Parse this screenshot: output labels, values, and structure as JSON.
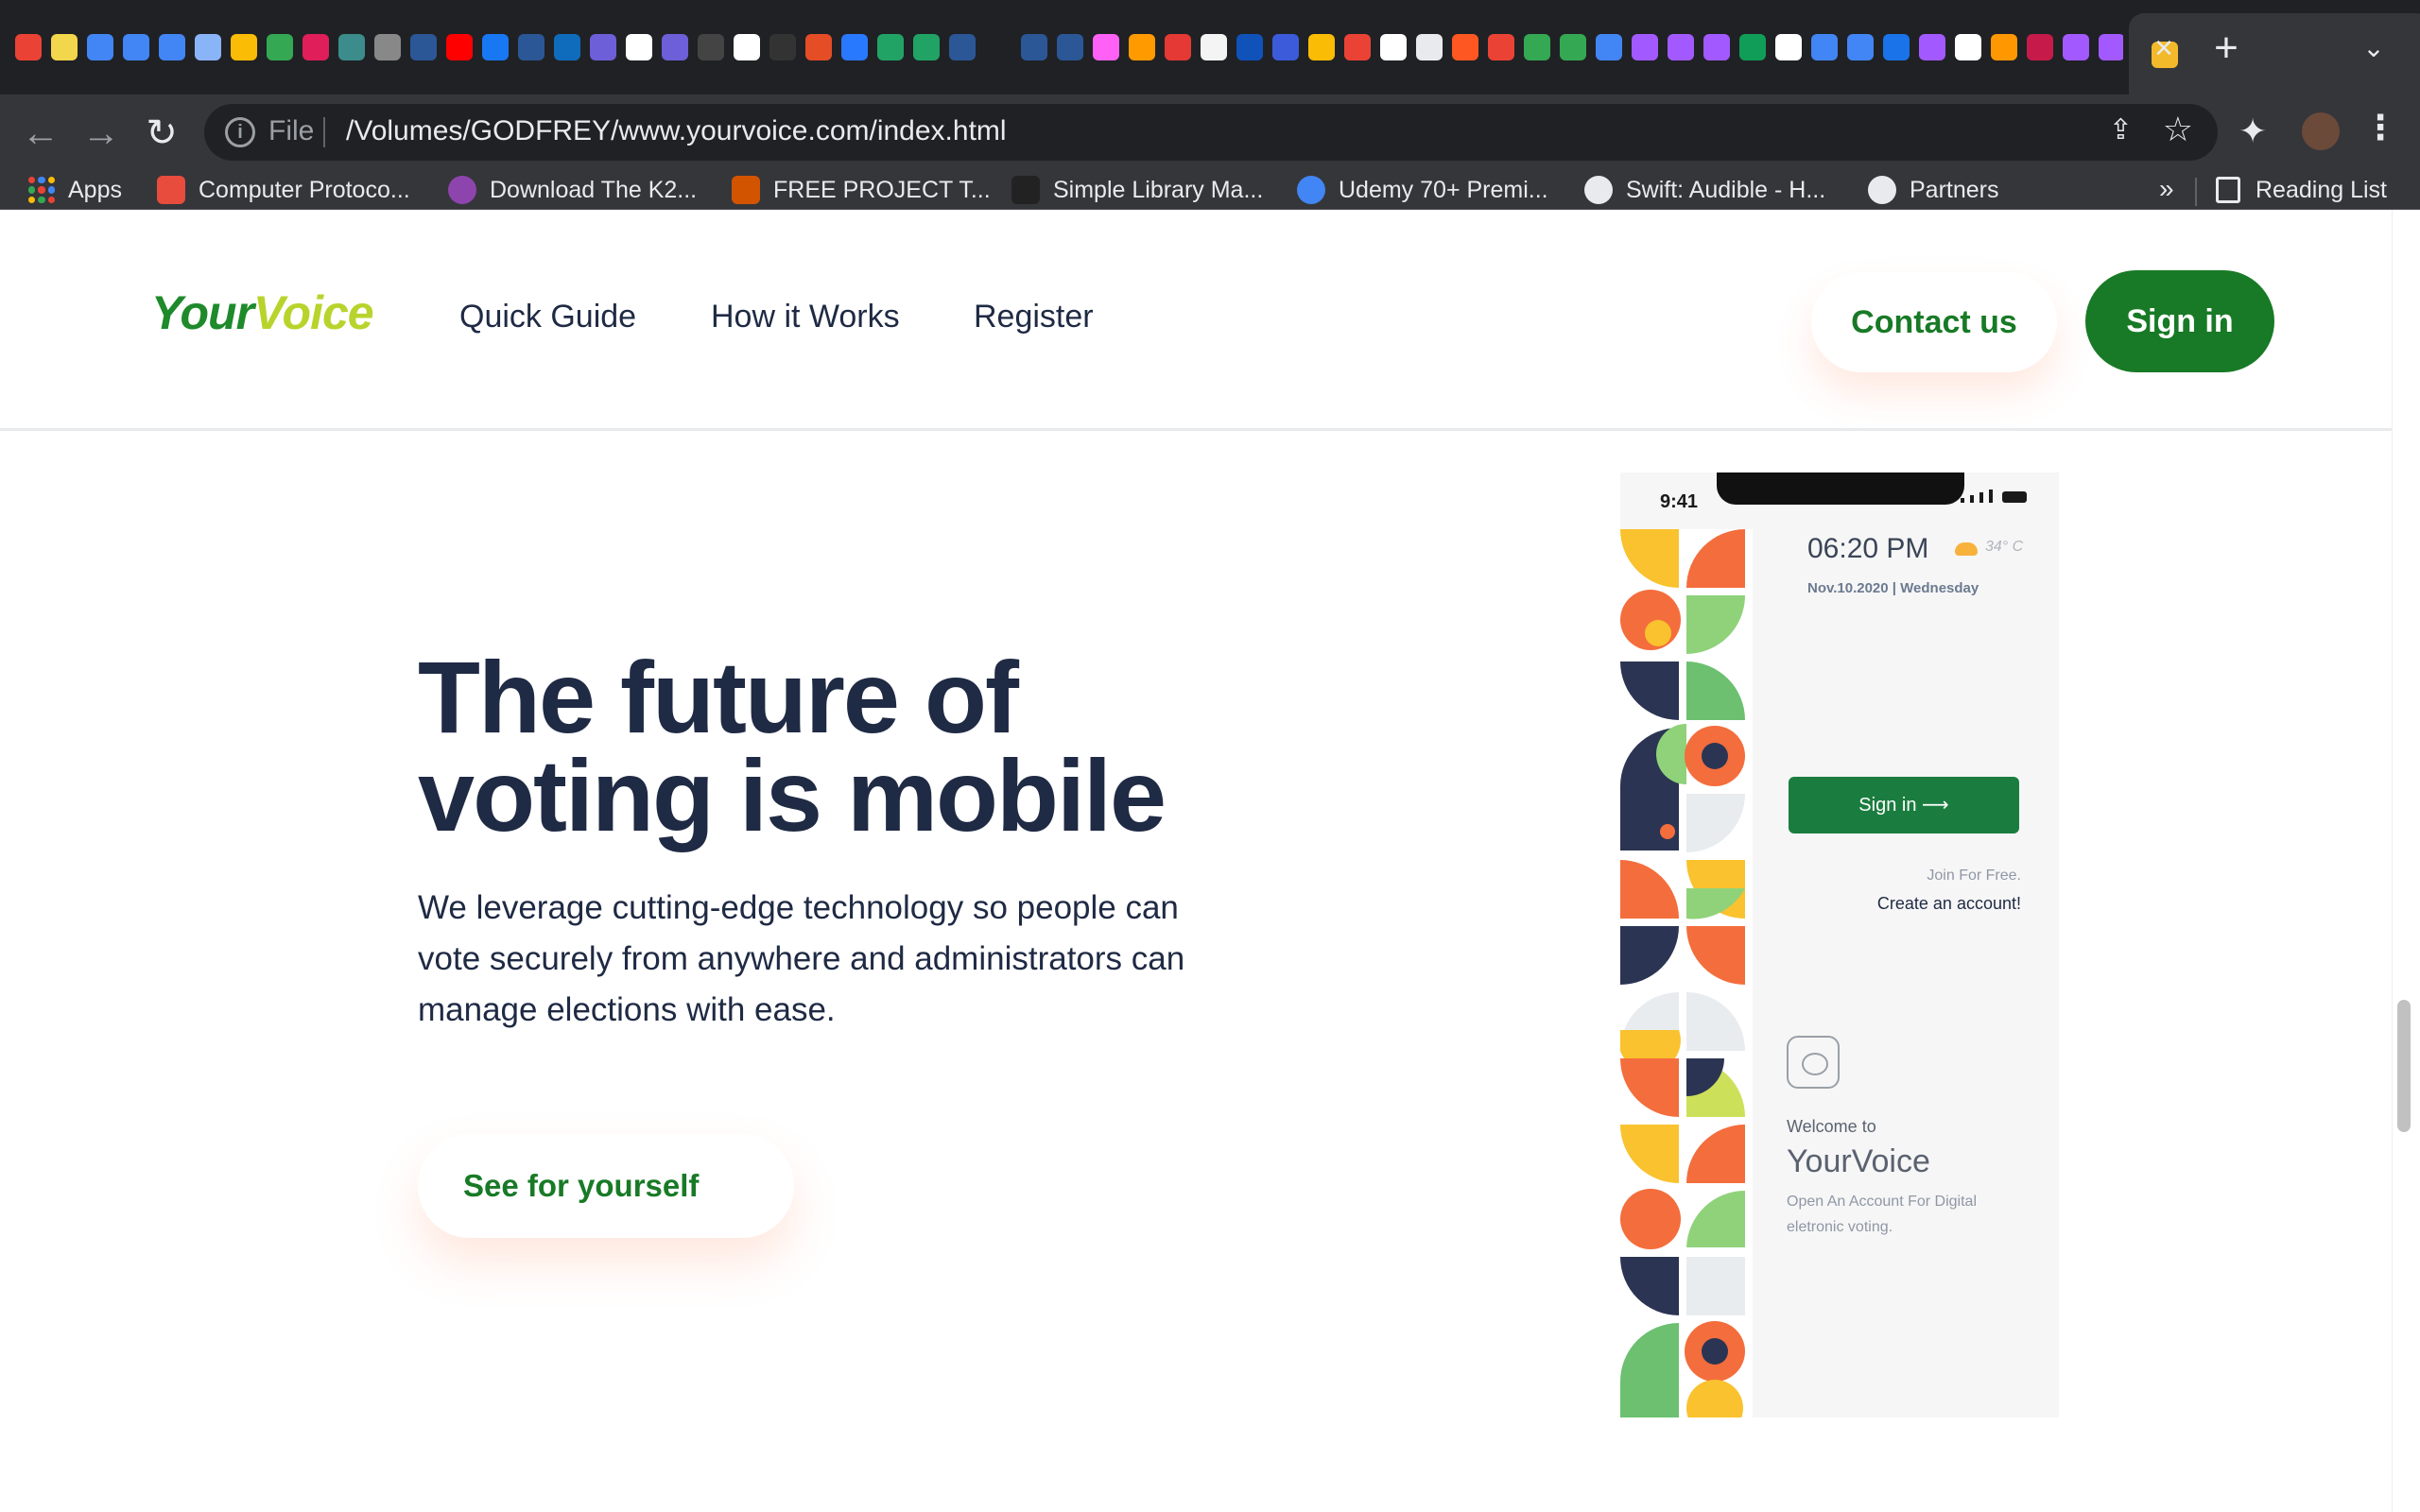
{
  "browser": {
    "tab_favicon_colors": [
      "#ea4335",
      "#f2d64b",
      "#4285f4",
      "#4285f4",
      "#4285f4",
      "#8ab4f8",
      "#fbbc05",
      "#34a853",
      "#e01e5a",
      "#3c8c8c",
      "#888888",
      "#2b5797",
      "#ff0000",
      "#1877f2",
      "#2b5797",
      "#0f6cbd",
      "#6d5fd8",
      "#ffffff",
      "#6d5fd8",
      "#444444",
      "#ffffff",
      "#333333",
      "#e44d26",
      "#2979ff",
      "#21a366",
      "#21a366",
      "#2b5797",
      "#202124",
      "#2b5797",
      "#2b5797",
      "#ff61f6",
      "#ff9a00",
      "#e53935",
      "#f4f4f4",
      "#0f52ba",
      "#3b5bdb",
      "#fbbc05",
      "#ea4335",
      "#ffffff",
      "#e8eaed",
      "#ff5722",
      "#ea4335",
      "#34a853",
      "#34a853",
      "#4285f4",
      "#a259ff",
      "#a259ff",
      "#a259ff",
      "#0f9d58",
      "#ffffff",
      "#4285f4",
      "#4285f4",
      "#1a73e8",
      "#a259ff",
      "#ffffff",
      "#ff9800",
      "#c51a4a",
      "#a259ff",
      "#a259ff",
      "#1a73e8",
      "#ffffff"
    ],
    "active_tab_favicon_color": "#f2b92a",
    "tab_close_icon": "×",
    "new_tab_icon": "+",
    "tab_search_icon": "⌄",
    "back_icon": "←",
    "forward_icon": "→",
    "reload_icon": "↻",
    "url_scheme": "File",
    "url": "/Volumes/GODFREY/www.yourvoice.com/index.html",
    "share_icon": "⇪",
    "bookmark_star_icon": "☆",
    "extensions_icon": "✦",
    "menu_icon": "⋮"
  },
  "bookmarks": {
    "apps_label": "Apps",
    "items": [
      {
        "label": "Computer Protoco...",
        "icon_color": "#e74c3c"
      },
      {
        "label": "Download The K2...",
        "icon_color": "#8e44ad"
      },
      {
        "label": "FREE PROJECT T...",
        "icon_color": "#d35400"
      },
      {
        "label": "Simple Library Ma...",
        "icon_color": "#222222"
      },
      {
        "label": "Udemy 70+ Premi...",
        "icon_color": "#4285f4"
      },
      {
        "label": "Swift: Audible - H...",
        "icon_color": "#e8eaed"
      },
      {
        "label": "Partners",
        "icon_color": "#e8eaed"
      }
    ],
    "overflow_label": "»",
    "reading_list_label": "Reading List"
  },
  "site": {
    "logo_part1": "Your",
    "logo_part2": "Voice",
    "nav": [
      "Quick Guide",
      "How it Works",
      "Register"
    ],
    "contact_label": "Contact us",
    "signin_label": "Sign in",
    "hero_title_line1": "The future of",
    "hero_title_line2": "voting is mobile",
    "hero_subtitle": "We leverage cutting-edge technology so people can vote securely from anywhere and administrators can manage elections with ease.",
    "cta_label": "See for yourself",
    "colors": {
      "brand_green": "#187a26",
      "logo_lime": "#b8d42c",
      "heading": "#1f2a44"
    }
  },
  "phone": {
    "status_time": "9:41",
    "clock": "06:20 PM",
    "temperature": "34° C",
    "date": "Nov.10.2020 | Wednesday",
    "welcome": "Welcome to",
    "app_name": "YourVoice",
    "description": "Open An Account For Digital eletronic voting.",
    "signin_label": "Sign in ⟶",
    "join_label": "Join For Free.",
    "create_label": "Create an account!"
  }
}
